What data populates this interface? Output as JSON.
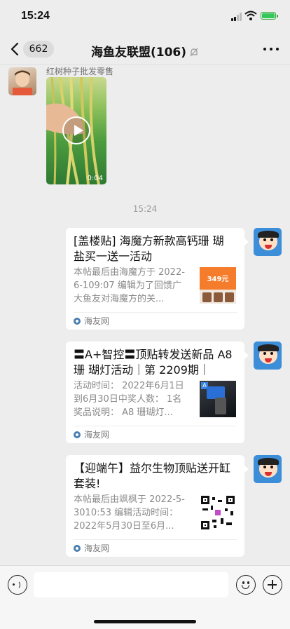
{
  "status_bar": {
    "time": "15:24"
  },
  "navbar": {
    "back_count": "662",
    "title": "海鱼友联盟(106)"
  },
  "messages": {
    "video": {
      "sender": "红树种子批发零售",
      "duration": "0:04"
    },
    "timestamp": "15:24",
    "cards": [
      {
        "title": "[盖楼贴] 海魔方新款高钙珊 瑚盐买一送一活动",
        "desc": "本帖最后由海魔方于 2022-6-109:07 编辑为了回馈广大鱼友对海魔方的关...",
        "source": "海友网",
        "thumb_text": "349元"
      },
      {
        "title": "〓A+智控〓顶贴转发送新品 A8珊 瑚灯活动｜第 2209期｜",
        "desc": "活动时间： 2022年6月1日到6月30日中奖人数： 1名奖品说明： A8 珊瑚灯...",
        "source": "海友网",
        "thumb_text": "A"
      },
      {
        "title": "【迎端午】益尔生物顶贴送开缸套装!",
        "desc": "本帖最后由飒枫于 2022-5-3010:53 编辑活动时间： 2022年5月30日至6月...",
        "source": "海友网"
      }
    ]
  },
  "colors": {
    "background": "#ededed",
    "card": "#ffffff",
    "meta_text": "#8a8a8a"
  },
  "icons": [
    "back-icon",
    "mute-icon",
    "more-icon",
    "play-icon",
    "voice-icon",
    "emoji-icon",
    "plus-icon"
  ]
}
